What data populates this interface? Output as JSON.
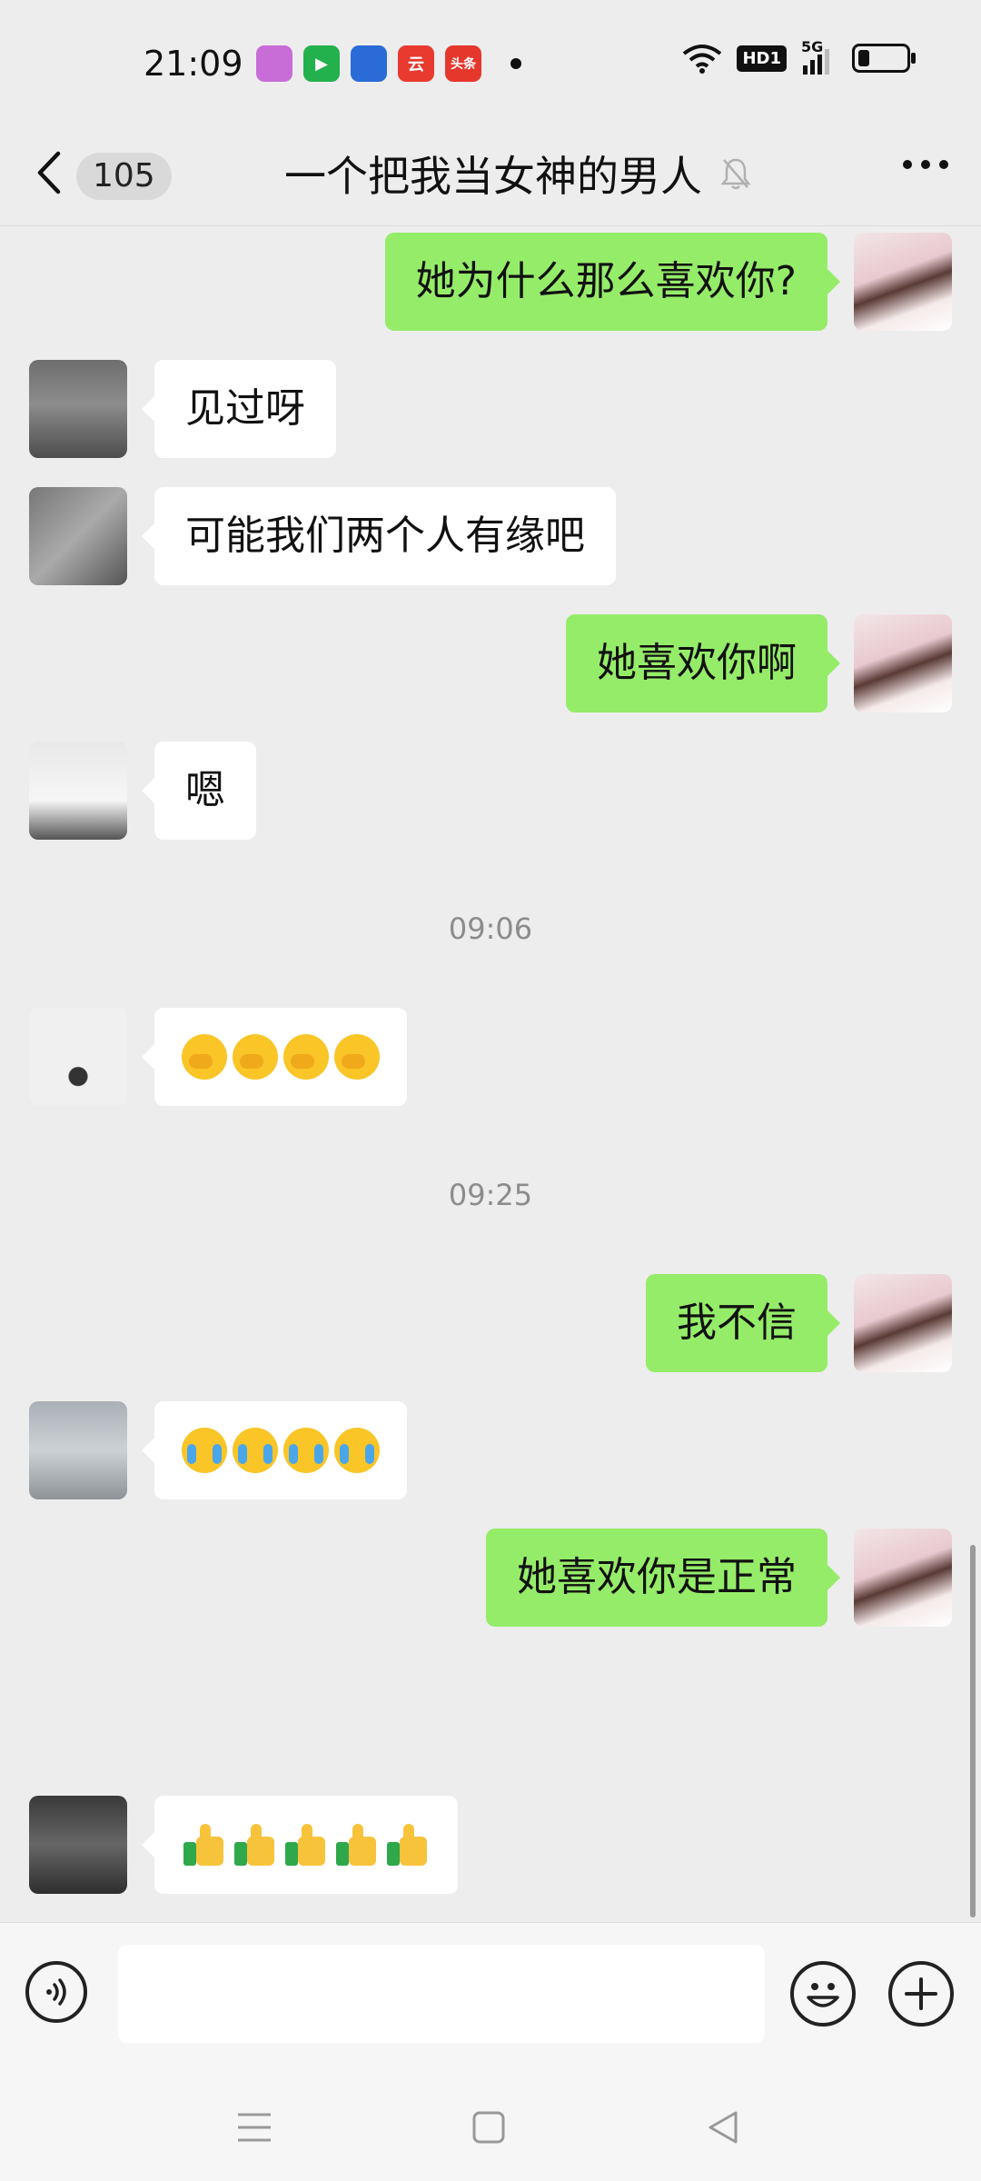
{
  "status_bar": {
    "time": "21:09",
    "hd_label": "HD1",
    "network": "5G",
    "apps": [
      {
        "icon": "app-icon-pink",
        "color": "#c86dd7",
        "label": ""
      },
      {
        "icon": "app-icon-green-play",
        "color": "#23b14d",
        "label": ""
      },
      {
        "icon": "app-icon-blue",
        "color": "#2a6bd8",
        "label": ""
      },
      {
        "icon": "app-icon-red-cloud",
        "color": "#e83a2f",
        "label": "云"
      },
      {
        "icon": "app-icon-toutiao",
        "color": "#e5372c",
        "label": "头条"
      }
    ]
  },
  "header": {
    "back_icon": "chevron-left-icon",
    "unread_count": "105",
    "title": "一个把我当女神的男人",
    "mute_icon": "bell-muted-icon",
    "more_icon": "more-dots-icon"
  },
  "messages": [
    {
      "side": "out",
      "text": "她为什么那么喜欢你?"
    },
    {
      "side": "in",
      "text": "见过呀"
    },
    {
      "side": "in",
      "text": "可能我们两个人有缘吧"
    },
    {
      "side": "out",
      "text": "她喜欢你啊"
    },
    {
      "side": "in",
      "text": "嗯"
    },
    {
      "timestamp": "09:06"
    },
    {
      "side": "in",
      "emoji": "hand-over-mouth-emoji",
      "count": 4
    },
    {
      "timestamp": "09:25"
    },
    {
      "side": "out",
      "text": "我不信"
    },
    {
      "side": "in",
      "emoji": "crying-laughing-emoji",
      "count": 4
    },
    {
      "side": "out",
      "text": "她喜欢你是正常"
    },
    {
      "side": "in",
      "emoji": "thumbs-up-emoji",
      "count": 5
    }
  ],
  "input_bar": {
    "voice_icon": "voice-icon",
    "value": "",
    "emoji_icon": "smiley-icon",
    "plus_icon": "plus-icon"
  },
  "nav_bar": {
    "menu_icon": "menu-icon",
    "home_icon": "home-square-icon",
    "back_icon": "back-triangle-icon"
  },
  "colors": {
    "background": "#ededed",
    "outgoing_bubble": "#95ec69",
    "incoming_bubble": "#ffffff"
  }
}
